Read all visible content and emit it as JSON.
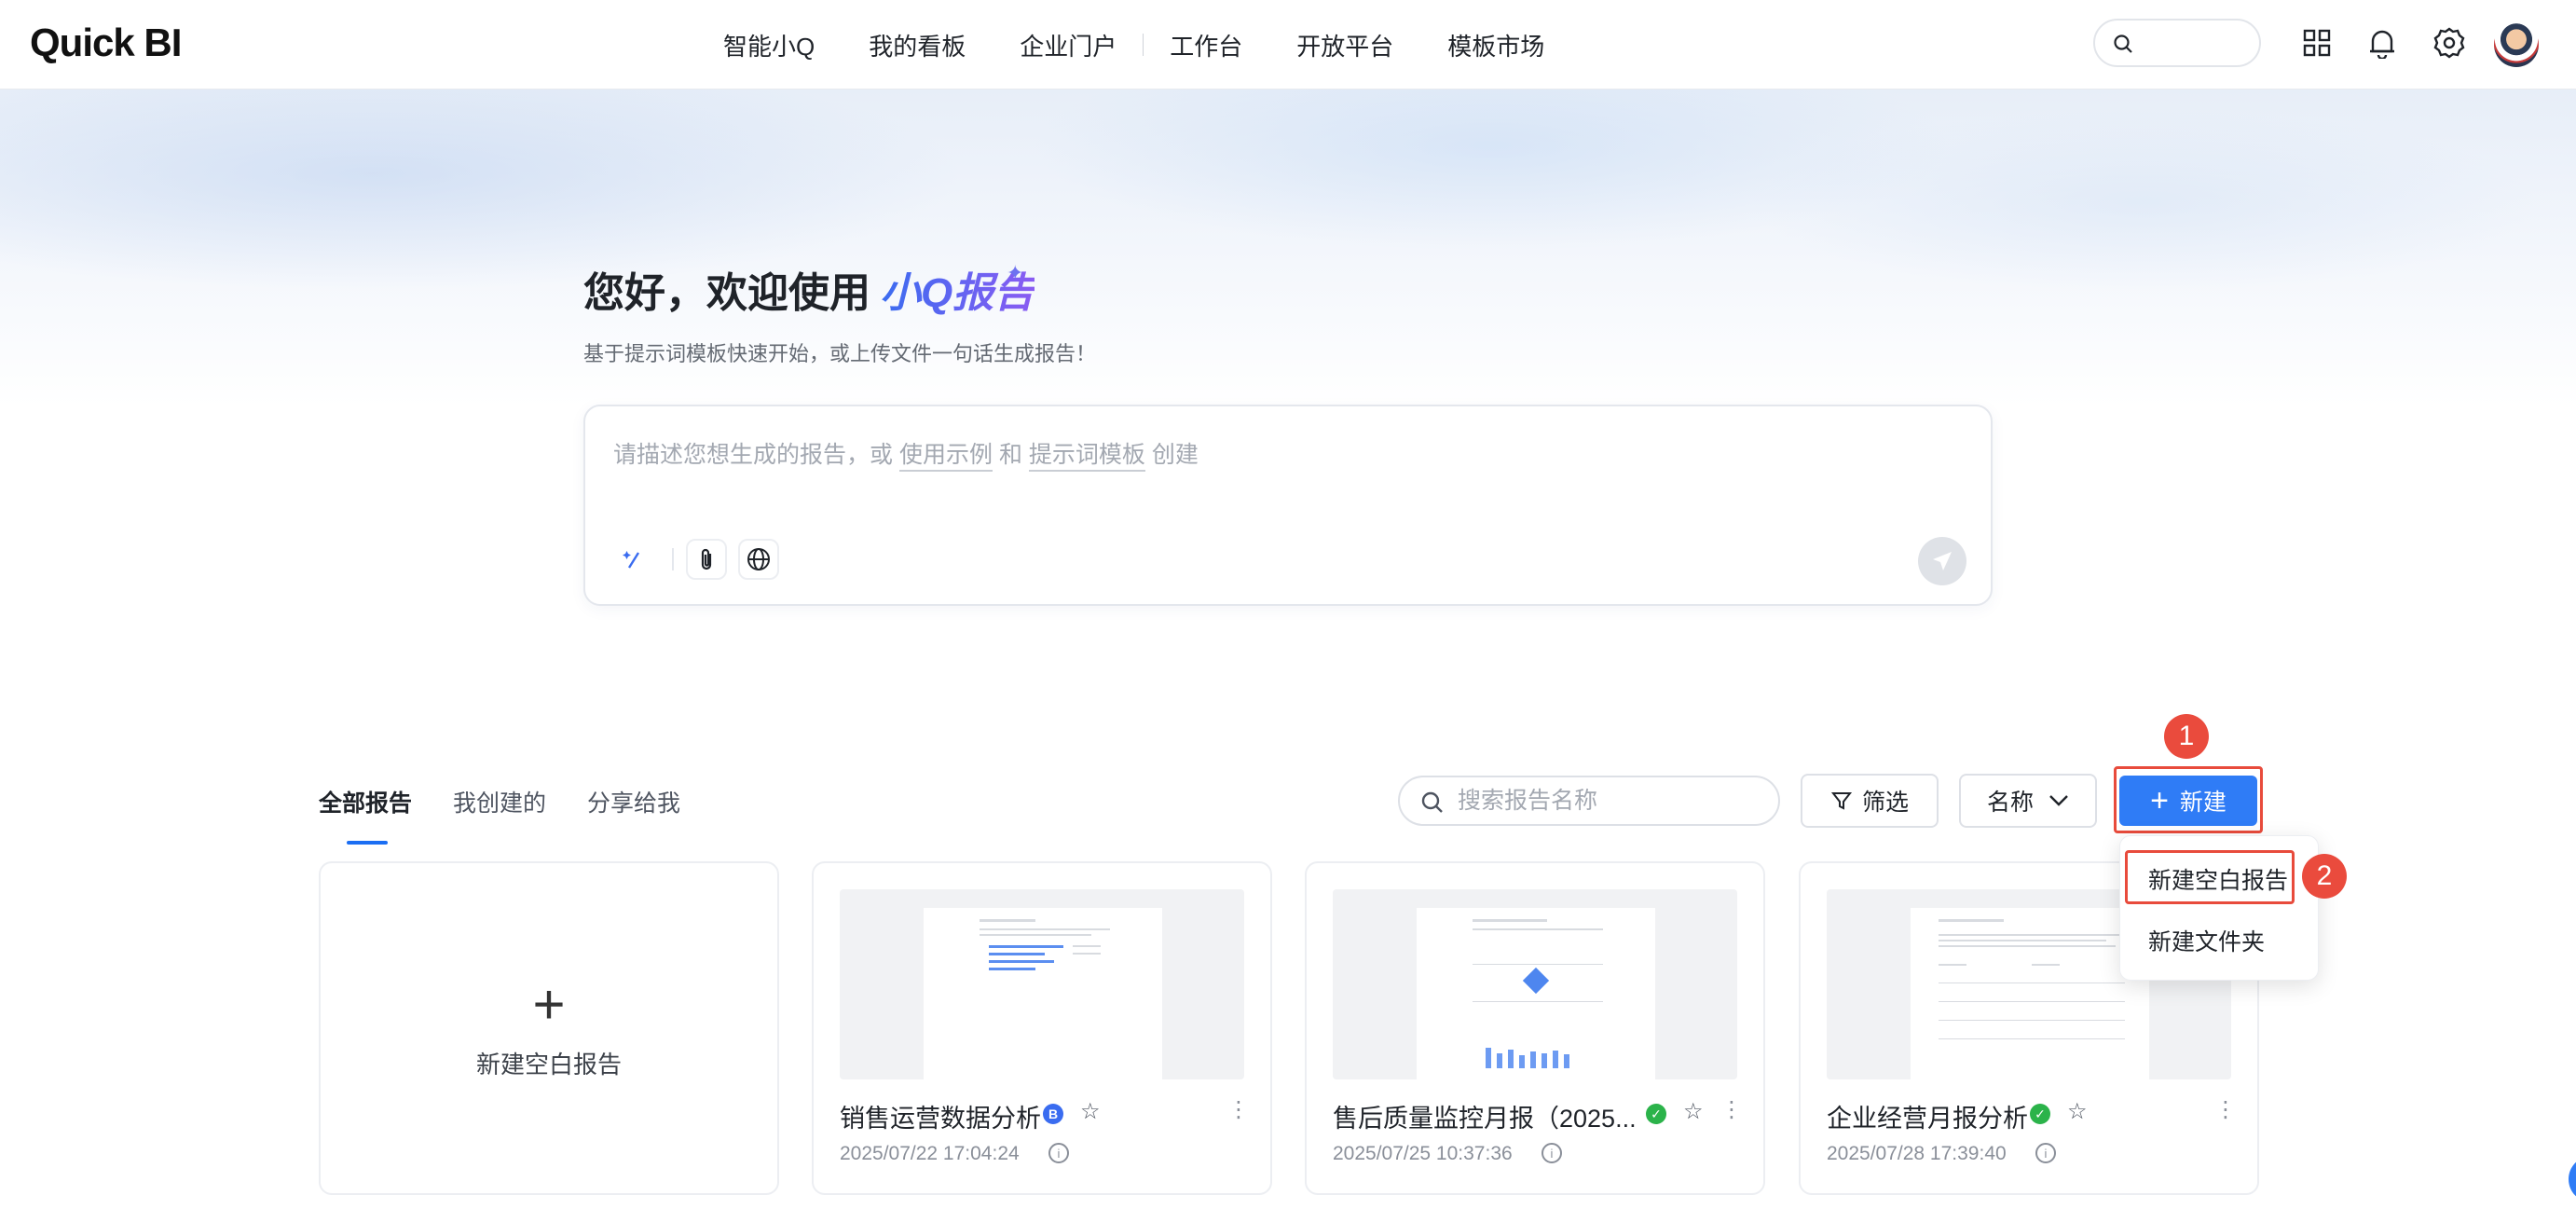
{
  "app": {
    "logo": "Quick BI"
  },
  "nav": {
    "items": [
      "智能小Q",
      "我的看板",
      "企业门户",
      "工作台",
      "开放平台",
      "模板市场"
    ]
  },
  "hero": {
    "greeting": "您好，欢迎使用",
    "brand": "小Q报告",
    "subtitle": "基于提示词模板快速开始，或上传文件一句话生成报告！",
    "prompt_prefix": "请描述您想生成的报告，或",
    "prompt_link1": "使用示例",
    "prompt_mid": "和",
    "prompt_link2": "提示词模板",
    "prompt_suffix": "创建"
  },
  "tabs": [
    "全部报告",
    "我创建的",
    "分享给我"
  ],
  "toolbar": {
    "search_placeholder": "搜索报告名称",
    "filter_label": "筛选",
    "sort_label": "名称",
    "new_label": "新建"
  },
  "dropdown": {
    "items": [
      "新建空白报告",
      "新建文件夹"
    ]
  },
  "steps": [
    "1",
    "2"
  ],
  "new_card": {
    "label": "新建空白报告"
  },
  "reports": [
    {
      "title": "销售运营数据分析",
      "date": "2025/07/22 17:04:24",
      "badge": "B",
      "badge_color": "#3a6cf0"
    },
    {
      "title": "售后质量监控月报（2025...",
      "date": "2025/07/25 10:37:36",
      "badge": "✓",
      "badge_color": "#2bb34a"
    },
    {
      "title": "企业经营月报分析",
      "date": "2025/07/28 17:39:40",
      "badge": "✓",
      "badge_color": "#2bb34a"
    }
  ],
  "colors": {
    "accent": "#2f7cf6",
    "highlight": "#e84b3c"
  }
}
